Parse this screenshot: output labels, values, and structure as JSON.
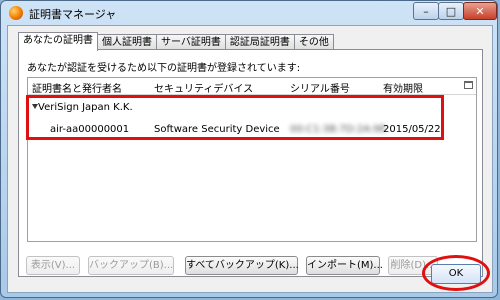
{
  "window": {
    "title": "証明書マネージャ"
  },
  "caption": {
    "minimize_glyph": "–",
    "maximize_glyph": "□",
    "close_glyph": "✕"
  },
  "tabs": [
    {
      "label": "あなたの証明書",
      "active": true
    },
    {
      "label": "個人証明書",
      "active": false
    },
    {
      "label": "サーバ証明書",
      "active": false
    },
    {
      "label": "認証局証明書",
      "active": false
    },
    {
      "label": "その他",
      "active": false
    }
  ],
  "panel": {
    "info_text": "あなたが認証を受けるため以下の証明書が登録されています:",
    "columns": [
      "証明書名と発行者名",
      "セキュリティデバイス",
      "シリアル番号",
      "有効期限"
    ],
    "organization": "VeriSign Japan K.K.",
    "certificate": {
      "name": "air-aa00000001",
      "device": "Software Security Device",
      "serial": "00:C1:3B:7D:2A:9E",
      "expires": "2015/05/22"
    }
  },
  "buttons": {
    "view": "表示(V)...",
    "backup": "バックアップ(B)...",
    "backup_all": "すべてバックアップ(K)...",
    "import": "インポート(M)...",
    "delete": "削除(D)...",
    "ok": "OK"
  },
  "colors": {
    "highlight": "#e01010"
  }
}
